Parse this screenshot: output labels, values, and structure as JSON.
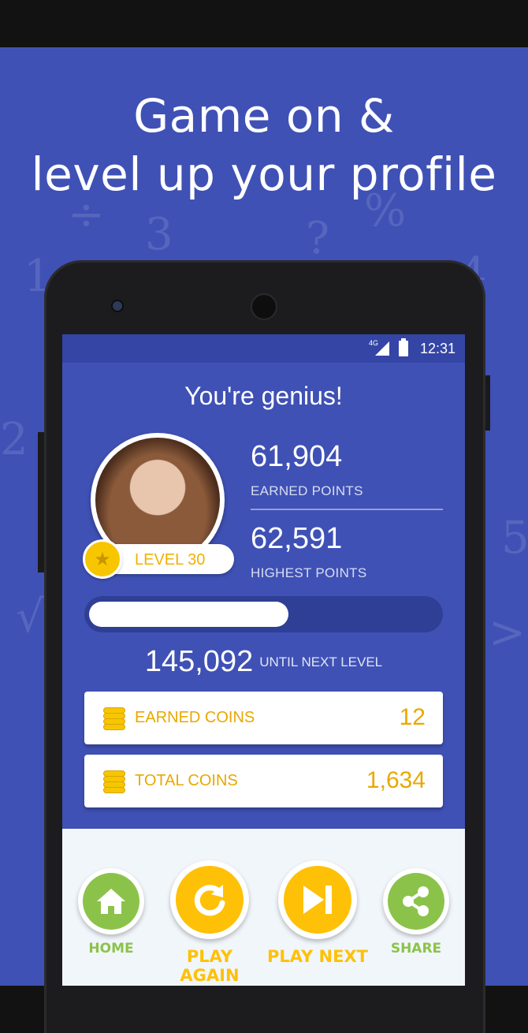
{
  "promo": {
    "headline_line1": "Game on &",
    "headline_line2": "level up your profile"
  },
  "status_bar": {
    "network": "4G",
    "time": "12:31"
  },
  "result": {
    "title": "You're genius!",
    "level_label": "LEVEL 30",
    "earned_points_value": "61,904",
    "earned_points_label": "EARNED POINTS",
    "highest_points_value": "62,591",
    "highest_points_label": "HIGHEST POINTS",
    "level_progress_fraction": 0.57,
    "until_next_value": "145,092",
    "until_next_label": "UNTIL NEXT LEVEL"
  },
  "coins": {
    "earned_label": "EARNED COINS",
    "earned_value": "12",
    "total_label": "TOTAL COINS",
    "total_value": "1,634"
  },
  "actions": {
    "home_label": "HOME",
    "play_again_label": "PLAY AGAIN",
    "play_next_label": "PLAY NEXT",
    "share_label": "SHARE"
  },
  "colors": {
    "brand_blue": "#3f51b5",
    "accent_yellow": "#f7c600",
    "coin_text": "#e8a800",
    "action_green": "#8bc34a"
  },
  "icons": [
    "signal-icon",
    "battery-icon",
    "star-badge-icon",
    "coin-stack-icon",
    "home-icon",
    "replay-icon",
    "skip-next-icon",
    "share-icon"
  ]
}
